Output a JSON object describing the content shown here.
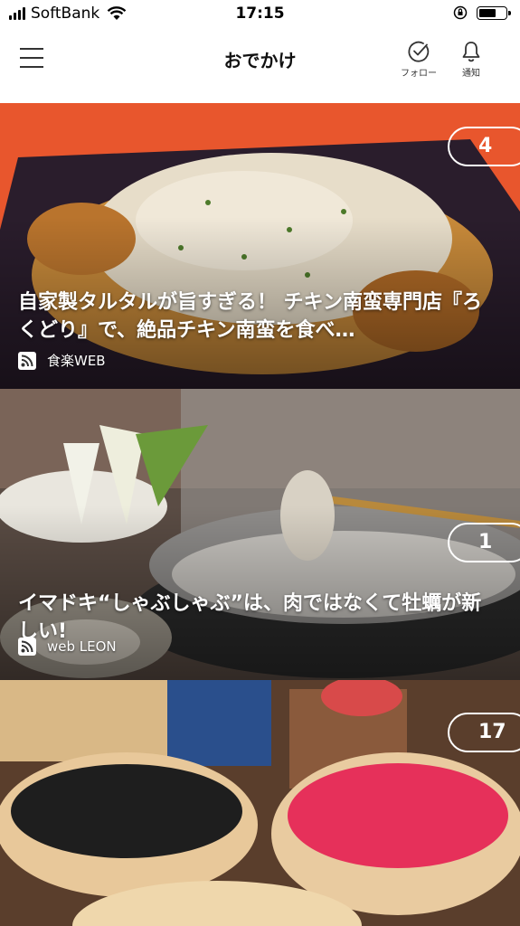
{
  "status_bar": {
    "carrier": "SoftBank",
    "time": "17:15",
    "battery_level": 0.65
  },
  "header": {
    "title": "おでかけ",
    "follow_label": "フォロー",
    "notify_label": "通知"
  },
  "articles": [
    {
      "title": "自家製タルタルが旨すぎる！ チキン南蛮専門店『ろくどり』で、絶品チキン南蛮を食べ…",
      "source": "食楽WEB",
      "count": "4"
    },
    {
      "title": "イマドキ“しゃぶしゃぶ”は、肉ではなくて牡蠣が新しい!",
      "source": "web LEON",
      "count": "1"
    },
    {
      "title": "",
      "source": "",
      "count": "17"
    }
  ]
}
